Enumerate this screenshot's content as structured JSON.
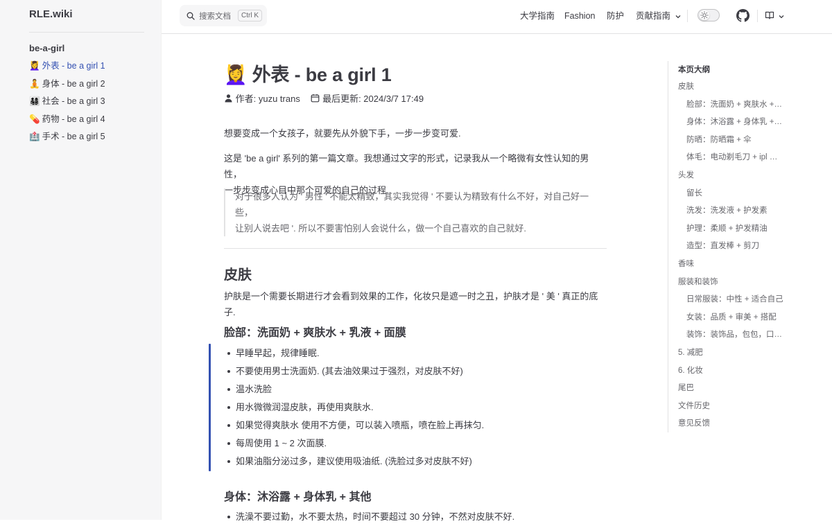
{
  "site": {
    "title": "RLE.wiki"
  },
  "sidebar": {
    "group_title": "be-a-girl",
    "items": [
      {
        "emoji": "💆‍♀️",
        "label": "外表 - be a girl 1",
        "active": true
      },
      {
        "emoji": "🧘",
        "label": "身体 - be a girl 2",
        "active": false
      },
      {
        "emoji": "👨‍👩‍👧‍👦",
        "label": "社会 - be a girl 3",
        "active": false
      },
      {
        "emoji": "💊",
        "label": "药物 - be a girl 4",
        "active": false
      },
      {
        "emoji": "🏥",
        "label": "手术 - be a girl 5",
        "active": false
      }
    ]
  },
  "search": {
    "placeholder": "搜索文档",
    "shortcut": "Ctrl K"
  },
  "nav": {
    "links": [
      "大学指南",
      "Fashion",
      "防护"
    ],
    "dropdown": "贡献指南"
  },
  "article": {
    "title_emoji": "💆‍♀️",
    "title": "外表 - be a girl 1",
    "author": "作者: yuzu trans",
    "last_updated": "最后更新: 2024/3/7 17:49",
    "intro": "想要变成一个女孩子，就要先从外貌下手，一步一步变可爱.",
    "para2_line1": "这是 'be a girl' 系列的第一篇文章。我想通过文字的形式，记录我从一个略微有女性认知的男性，",
    "para2_line2": "一步步变成心目中那个可爱的自己的过程.",
    "quote_line1": "对于很多人认为 ' 男性 ' 不能太精致，其实我觉得 ' 不要认为精致有什么不好，对自己好一些，",
    "quote_line2": "让别人说去吧 '. 所以不要害怕别人会说什么，做一个自己喜欢的自己就好.",
    "h2_skin": "皮肤",
    "skin_intro": "护肤是一个需要长期进行才会看到效果的工作，化妆只是遮一时之丑，护肤才是 ' 美 ' 真正的底子.",
    "h3_face": "脸部：洗面奶 + 爽肤水 + 乳液 + 面膜",
    "face_bullets": [
      "早睡早起，规律睡眠.",
      "不要使用男士洗面奶. (其去油效果过于强烈，对皮肤不好)",
      "温水洗脸",
      "用水微微润湿皮肤，再使用爽肤水.",
      "如果觉得爽肤水 使用不方便，可以装入喷瓶，喷在脸上再抹匀.",
      "每周使用 1 ~ 2 次面膜.",
      "如果油脂分泌过多，建议使用吸油纸. (洗脸过多对皮肤不好)"
    ],
    "h3_body": "身体：沐浴露 + 身体乳 + 其他",
    "body_bullets": [
      "洗澡不要过勤，水不要太热，时间不要超过 30 分钟，不然对皮肤不好."
    ]
  },
  "outline": {
    "title": "本页大纲",
    "items": [
      {
        "label": "皮肤",
        "level": 1
      },
      {
        "label": "脸部：洗面奶 + 爽肤水 + 乳液 + 面膜",
        "level": 2
      },
      {
        "label": "身体：沐浴露 + 身体乳 + 其他",
        "level": 2
      },
      {
        "label": "防晒：防晒霜 + 伞",
        "level": 2
      },
      {
        "label": "体毛：电动剃毛刀 + ipl 脱毛仪",
        "level": 2
      },
      {
        "label": "头发",
        "level": 1
      },
      {
        "label": "留长",
        "level": 2
      },
      {
        "label": "洗发：洗发液 + 护发素",
        "level": 2
      },
      {
        "label": "护理：柔顺 + 护发精油",
        "level": 2
      },
      {
        "label": "造型：直发棒 + 剪刀",
        "level": 2
      },
      {
        "label": "香味",
        "level": 1
      },
      {
        "label": "服装和装饰",
        "level": 1
      },
      {
        "label": "日常服装：中性 + 适合自己",
        "level": 2
      },
      {
        "label": "女装：品质 + 审美 + 搭配",
        "level": 2
      },
      {
        "label": "装饰：装饰品，包包，口罩等",
        "level": 2
      },
      {
        "label": "5. 减肥",
        "level": 1
      },
      {
        "label": "6. 化妆",
        "level": 1
      },
      {
        "label": "尾巴",
        "level": 1
      },
      {
        "label": "文件历史",
        "level": 1
      },
      {
        "label": "意见反馈",
        "level": 1
      }
    ]
  },
  "colors": {
    "accent": "#3451b2",
    "text": "#3c3c43",
    "muted": "#67676c",
    "sidebar_bg": "#f6f6f7"
  }
}
